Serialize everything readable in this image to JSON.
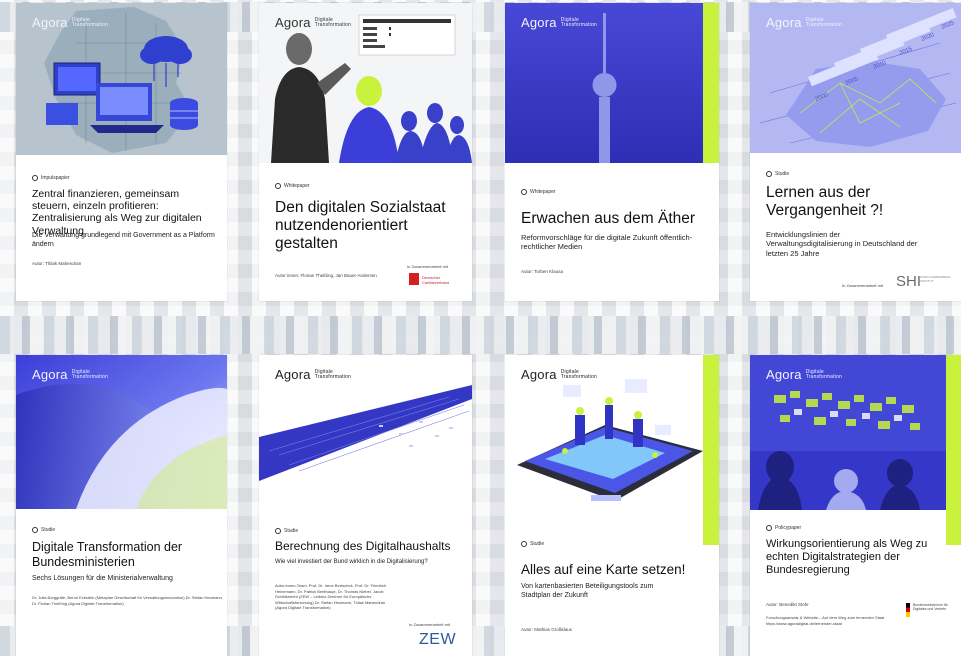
{
  "colors": {
    "accent": "#c8f23c",
    "blue": "#3d3fd6",
    "deep_blue": "#2b2fb8",
    "pale_blue": "#9fb6ff"
  },
  "covers": [
    {
      "logo": "Agora",
      "logo_sub": "Digitale Transformation",
      "kind": "Impulspapier",
      "title": "Zentral finanzieren, gemeinsam steuern, einzeln profitieren: Zentralisierung als Weg zur digitalen Verwaltung",
      "subtitle": "Die Verwaltung grundlegend mit Government as a Platform ändern",
      "author": "Autor: Thilak Mahendran"
    },
    {
      "logo": "Agora",
      "logo_sub": "Digitale Transformation",
      "kind": "Whitepaper",
      "title": "Den digitalen Sozialstaat nutzendenorientiert gestalten",
      "author": "Autor:innen: Florian Theißing, Jan Bauer-Andersen",
      "partner_label": "In Zusammenarbeit mit",
      "partner_name": "Deutscher Caritasverband"
    },
    {
      "logo": "Agora",
      "logo_sub": "Digitale Transformation",
      "kind": "Whitepaper",
      "title": "Erwachen aus dem Äther",
      "subtitle": "Reformvorschläge für die digitale Zukunft öffentlich-rechtlicher Medien",
      "author": "Autor: Torben Klausa"
    },
    {
      "logo": "Agora",
      "logo_sub": "Digitale Transformation",
      "kind": "Studie",
      "title": "Lernen aus der Vergangenheit ?!",
      "subtitle": "Entwicklungslinien der Verwaltungsdigitalisierung in Deutschland der letzten 25 Jahre",
      "partner_label": "In Zusammenarbeit mit",
      "partner_name": "SHI",
      "partner_note": "STEIN HARDENBERG INSTITUT",
      "years": [
        "2000",
        "2005",
        "2010",
        "2015",
        "2020",
        "2025"
      ]
    },
    {
      "logo": "Agora",
      "logo_sub": "Digitale Transformation",
      "kind": "Studie",
      "title": "Digitale Transformation der Bundesministerien",
      "subtitle": "Sechs Lösungen für die Ministerialverwaltung",
      "author": "Dr. Julia Borggräfe, Bernd Eckstein (Metaplan Gesellschaft für Verwaltungsinnovation) Dr. Stefan Heumann, Dr. Florian Theißing (Agora Digitale Transformation)"
    },
    {
      "logo": "Agora",
      "logo_sub": "Digitale Transformation",
      "kind": "Studie",
      "title": "Berechnung des Digitalhaushalts",
      "subtitle": "Wie viel investiert der Bund wirklich in die Digitalisierung?",
      "author": "Autor:innen-Team: Prof. Dr. Irene Bertschek, Prof. Dr. Friedrich Heinemann, Dr. Patrick Breithaupt, Dr. Thomas Niebel, Jacob Schildknecht (ZEW – Leibniz-Zentrum für Europäische Wirtschaftsforschung) Dr. Stefan Heumann, Thilak Mahendran (Agora Digitale Transformation)",
      "partner_label": "In Zusammenarbeit mit",
      "partner_name": "ZEW"
    },
    {
      "logo": "Agora",
      "logo_sub": "Digitale Transformation",
      "kind": "Studie",
      "title": "Alles auf eine Karte setzen!",
      "subtitle": "Von kartenbasierten Beteiligungstools zum Stadtplan der Zukunft",
      "author": "Autor: Mathias Großklaus"
    },
    {
      "logo": "Agora",
      "logo_sub": "Digitale Transformation",
      "kind": "Policypaper",
      "title": "Wirkungsorientierung als Weg zu echten Digitalstrategien der Bundesregierung",
      "author": "Autor: Benedikt Stöhr",
      "note": "Forschungsansatz & Website – Auf dem Weg zum lernenden Staat https://www.agoradigital.de/lernender-staat",
      "partner_name": "Bundesministerium für Digitales und Verkehr"
    }
  ]
}
